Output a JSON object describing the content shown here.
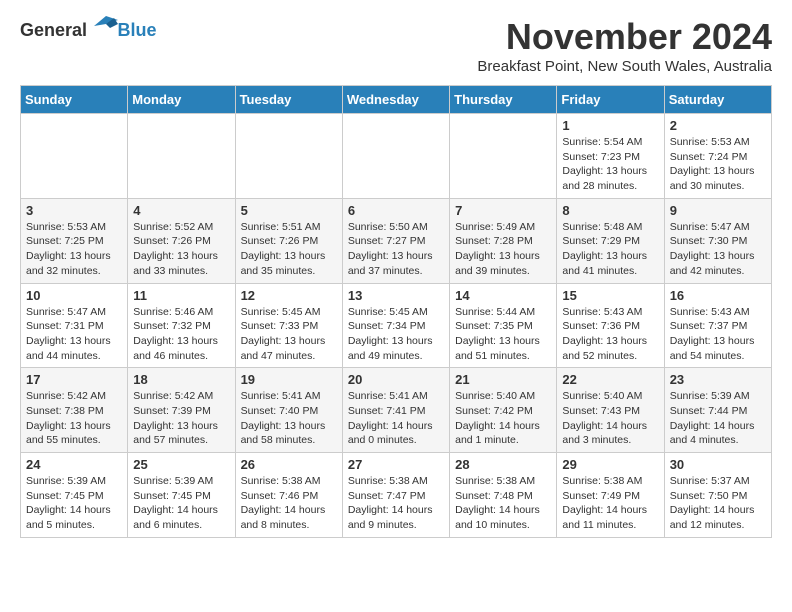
{
  "logo": {
    "general": "General",
    "blue": "Blue"
  },
  "title": "November 2024",
  "subtitle": "Breakfast Point, New South Wales, Australia",
  "days_of_week": [
    "Sunday",
    "Monday",
    "Tuesday",
    "Wednesday",
    "Thursday",
    "Friday",
    "Saturday"
  ],
  "weeks": [
    [
      {
        "day": "",
        "info": ""
      },
      {
        "day": "",
        "info": ""
      },
      {
        "day": "",
        "info": ""
      },
      {
        "day": "",
        "info": ""
      },
      {
        "day": "",
        "info": ""
      },
      {
        "day": "1",
        "info": "Sunrise: 5:54 AM\nSunset: 7:23 PM\nDaylight: 13 hours\nand 28 minutes."
      },
      {
        "day": "2",
        "info": "Sunrise: 5:53 AM\nSunset: 7:24 PM\nDaylight: 13 hours\nand 30 minutes."
      }
    ],
    [
      {
        "day": "3",
        "info": "Sunrise: 5:53 AM\nSunset: 7:25 PM\nDaylight: 13 hours\nand 32 minutes."
      },
      {
        "day": "4",
        "info": "Sunrise: 5:52 AM\nSunset: 7:26 PM\nDaylight: 13 hours\nand 33 minutes."
      },
      {
        "day": "5",
        "info": "Sunrise: 5:51 AM\nSunset: 7:26 PM\nDaylight: 13 hours\nand 35 minutes."
      },
      {
        "day": "6",
        "info": "Sunrise: 5:50 AM\nSunset: 7:27 PM\nDaylight: 13 hours\nand 37 minutes."
      },
      {
        "day": "7",
        "info": "Sunrise: 5:49 AM\nSunset: 7:28 PM\nDaylight: 13 hours\nand 39 minutes."
      },
      {
        "day": "8",
        "info": "Sunrise: 5:48 AM\nSunset: 7:29 PM\nDaylight: 13 hours\nand 41 minutes."
      },
      {
        "day": "9",
        "info": "Sunrise: 5:47 AM\nSunset: 7:30 PM\nDaylight: 13 hours\nand 42 minutes."
      }
    ],
    [
      {
        "day": "10",
        "info": "Sunrise: 5:47 AM\nSunset: 7:31 PM\nDaylight: 13 hours\nand 44 minutes."
      },
      {
        "day": "11",
        "info": "Sunrise: 5:46 AM\nSunset: 7:32 PM\nDaylight: 13 hours\nand 46 minutes."
      },
      {
        "day": "12",
        "info": "Sunrise: 5:45 AM\nSunset: 7:33 PM\nDaylight: 13 hours\nand 47 minutes."
      },
      {
        "day": "13",
        "info": "Sunrise: 5:45 AM\nSunset: 7:34 PM\nDaylight: 13 hours\nand 49 minutes."
      },
      {
        "day": "14",
        "info": "Sunrise: 5:44 AM\nSunset: 7:35 PM\nDaylight: 13 hours\nand 51 minutes."
      },
      {
        "day": "15",
        "info": "Sunrise: 5:43 AM\nSunset: 7:36 PM\nDaylight: 13 hours\nand 52 minutes."
      },
      {
        "day": "16",
        "info": "Sunrise: 5:43 AM\nSunset: 7:37 PM\nDaylight: 13 hours\nand 54 minutes."
      }
    ],
    [
      {
        "day": "17",
        "info": "Sunrise: 5:42 AM\nSunset: 7:38 PM\nDaylight: 13 hours\nand 55 minutes."
      },
      {
        "day": "18",
        "info": "Sunrise: 5:42 AM\nSunset: 7:39 PM\nDaylight: 13 hours\nand 57 minutes."
      },
      {
        "day": "19",
        "info": "Sunrise: 5:41 AM\nSunset: 7:40 PM\nDaylight: 13 hours\nand 58 minutes."
      },
      {
        "day": "20",
        "info": "Sunrise: 5:41 AM\nSunset: 7:41 PM\nDaylight: 14 hours\nand 0 minutes."
      },
      {
        "day": "21",
        "info": "Sunrise: 5:40 AM\nSunset: 7:42 PM\nDaylight: 14 hours\nand 1 minute."
      },
      {
        "day": "22",
        "info": "Sunrise: 5:40 AM\nSunset: 7:43 PM\nDaylight: 14 hours\nand 3 minutes."
      },
      {
        "day": "23",
        "info": "Sunrise: 5:39 AM\nSunset: 7:44 PM\nDaylight: 14 hours\nand 4 minutes."
      }
    ],
    [
      {
        "day": "24",
        "info": "Sunrise: 5:39 AM\nSunset: 7:45 PM\nDaylight: 14 hours\nand 5 minutes."
      },
      {
        "day": "25",
        "info": "Sunrise: 5:39 AM\nSunset: 7:45 PM\nDaylight: 14 hours\nand 6 minutes."
      },
      {
        "day": "26",
        "info": "Sunrise: 5:38 AM\nSunset: 7:46 PM\nDaylight: 14 hours\nand 8 minutes."
      },
      {
        "day": "27",
        "info": "Sunrise: 5:38 AM\nSunset: 7:47 PM\nDaylight: 14 hours\nand 9 minutes."
      },
      {
        "day": "28",
        "info": "Sunrise: 5:38 AM\nSunset: 7:48 PM\nDaylight: 14 hours\nand 10 minutes."
      },
      {
        "day": "29",
        "info": "Sunrise: 5:38 AM\nSunset: 7:49 PM\nDaylight: 14 hours\nand 11 minutes."
      },
      {
        "day": "30",
        "info": "Sunrise: 5:37 AM\nSunset: 7:50 PM\nDaylight: 14 hours\nand 12 minutes."
      }
    ]
  ]
}
